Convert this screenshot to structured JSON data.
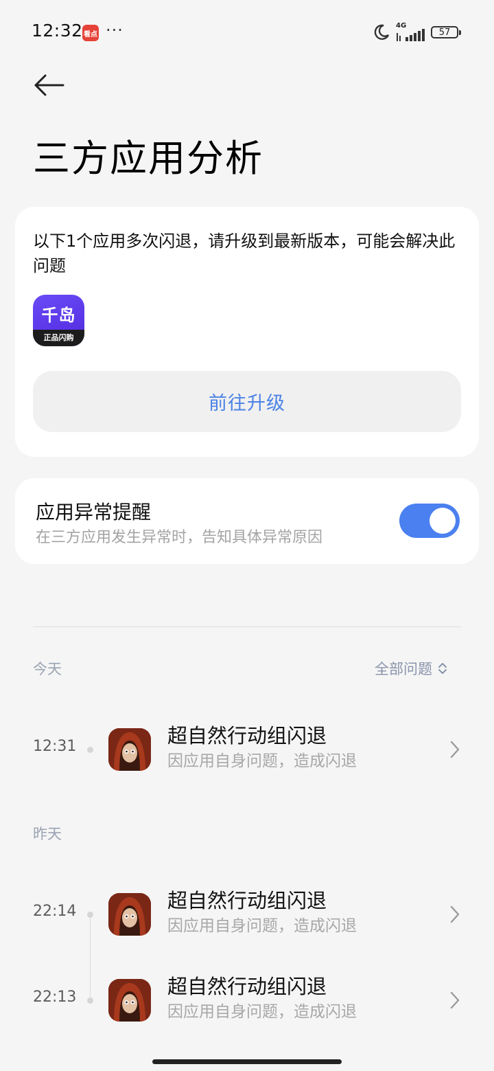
{
  "status_bar": {
    "time": "12:32",
    "news_icon_text": "看点",
    "more_dots": "···",
    "network": "4G",
    "battery": "57"
  },
  "page": {
    "title": "三方应用分析"
  },
  "upgrade_card": {
    "message": "以下1个应用多次闪退，请升级到最新版本，可能会解决此问题",
    "app_icon_text": "千岛",
    "app_icon_band": "正品闪购",
    "button_label": "前往升级"
  },
  "reminder": {
    "title": "应用异常提醒",
    "subtitle": "在三方应用发生异常时，告知具体异常原因",
    "enabled": true
  },
  "history": {
    "filter_label": "全部问题",
    "groups": [
      {
        "label": "今天",
        "items": [
          {
            "time": "12:31",
            "title": "超自然行动组闪退",
            "reason": "因应用自身问题，造成闪退"
          }
        ]
      },
      {
        "label": "昨天",
        "items": [
          {
            "time": "22:14",
            "title": "超自然行动组闪退",
            "reason": "因应用自身问题，造成闪退"
          },
          {
            "time": "22:13",
            "title": "超自然行动组闪退",
            "reason": "因应用自身问题，造成闪退"
          }
        ]
      }
    ]
  },
  "icons": {
    "back": "arrow-left-icon",
    "moon": "moon-icon",
    "signal": "signal-icon",
    "chevron": "chevron-right-icon",
    "filter": "updown-icon"
  },
  "colors": {
    "accent": "#4a80f0",
    "button_text": "#4b82e6",
    "background": "#f5f5f5"
  }
}
